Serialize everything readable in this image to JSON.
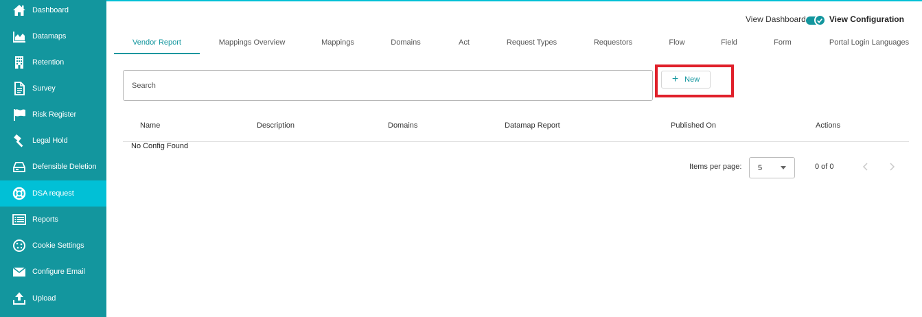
{
  "sidebar": {
    "items": [
      {
        "label": "Dashboard",
        "icon": "home-icon"
      },
      {
        "label": "Datamaps",
        "icon": "area-chart-icon"
      },
      {
        "label": "Retention",
        "icon": "building-icon"
      },
      {
        "label": "Survey",
        "icon": "document-icon"
      },
      {
        "label": "Risk Register",
        "icon": "flag-icon"
      },
      {
        "label": "Legal Hold",
        "icon": "gavel-icon"
      },
      {
        "label": "Defensible Deletion",
        "icon": "drive-icon"
      },
      {
        "label": "DSA request",
        "icon": "lifebuoy-icon",
        "active": true
      },
      {
        "label": "Reports",
        "icon": "list-icon"
      },
      {
        "label": "Cookie Settings",
        "icon": "cookie-icon"
      },
      {
        "label": "Configure Email",
        "icon": "envelope-icon"
      },
      {
        "label": "Upload",
        "icon": "upload-icon"
      }
    ]
  },
  "toggle": {
    "left_label": "View Dashboard",
    "right_label": "View Configuration",
    "checked": true
  },
  "tabs": [
    {
      "label": "Vendor Report",
      "active": true
    },
    {
      "label": "Mappings Overview"
    },
    {
      "label": "Mappings"
    },
    {
      "label": "Domains"
    },
    {
      "label": "Act"
    },
    {
      "label": "Request Types"
    },
    {
      "label": "Requestors"
    },
    {
      "label": "Flow"
    },
    {
      "label": "Field"
    },
    {
      "label": "Form"
    },
    {
      "label": "Portal Login Languages"
    }
  ],
  "search": {
    "placeholder": "Search",
    "value": ""
  },
  "new_button": {
    "label": "New",
    "icon": "plus-icon"
  },
  "table": {
    "columns": [
      "Name",
      "Description",
      "Domains",
      "Datamap Report",
      "Published On",
      "Actions"
    ],
    "empty_message": "No Config Found"
  },
  "paginator": {
    "items_per_page_label": "Items per page:",
    "page_size": "5",
    "range_label": "0 of 0"
  },
  "colors": {
    "sidebar": "#13969e",
    "active": "#01c0d6",
    "accent": "#13969e",
    "highlight": "#e0202a"
  }
}
